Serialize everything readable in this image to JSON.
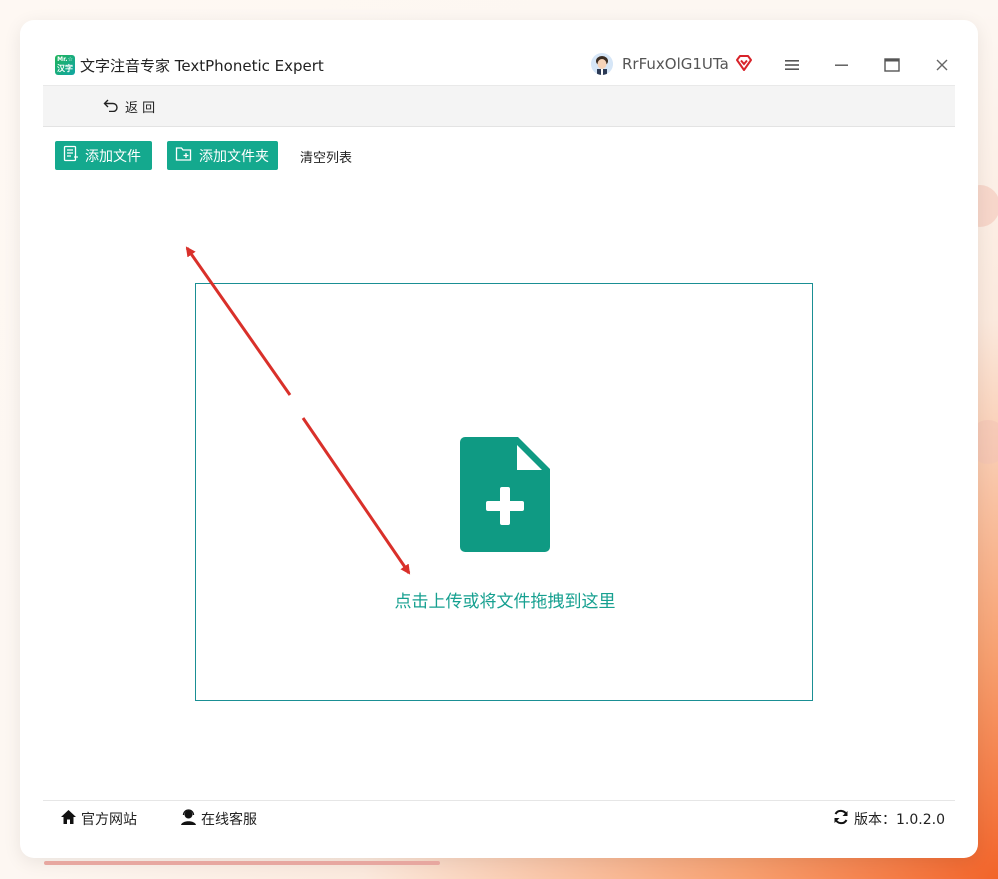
{
  "app": {
    "logo_text": "汉字",
    "title": "文字注音专家 TextPhonetic Expert"
  },
  "user": {
    "name": "RrFuxOlG1UTa"
  },
  "nav": {
    "back_label": "返 回"
  },
  "toolbar": {
    "add_file_label": "添加文件",
    "add_folder_label": "添加文件夹",
    "clear_list_label": "清空列表"
  },
  "dropzone": {
    "text": "点击上传或将文件拖拽到这里"
  },
  "footer": {
    "website_label": "官方网站",
    "support_label": "在线客服",
    "version_label": "版本：1.0.2.0"
  },
  "colors": {
    "accent": "#14a98e",
    "drop_border": "#1a8f94",
    "annotation_arrow": "#d9302a",
    "vip": "#d8232a"
  },
  "icons": [
    "app-logo-icon",
    "user-avatar",
    "vip-icon",
    "menu-icon",
    "minimize-icon",
    "maximize-icon",
    "close-icon",
    "back-icon",
    "file-list-icon",
    "folder-add-icon",
    "file-add-icon",
    "home-icon",
    "support-icon",
    "refresh-icon"
  ]
}
